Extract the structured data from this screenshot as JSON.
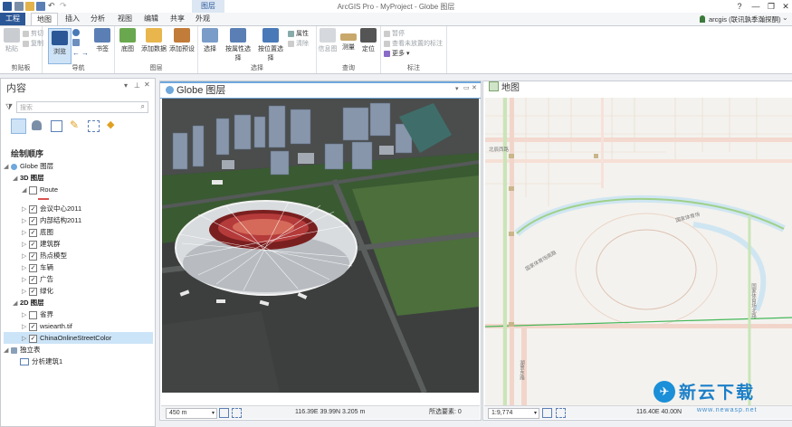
{
  "app": {
    "title": "ArcGIS Pro - MyProject - Globe 图层",
    "context_tab": "图层",
    "user": "arcgis (联讯孰季瀚探酮)"
  },
  "window_controls": {
    "help": "?",
    "minimize": "—",
    "restore": "❐",
    "close": "✕"
  },
  "tabs": [
    {
      "label": "工程",
      "active": false
    },
    {
      "label": "地图",
      "active": true
    },
    {
      "label": "插入",
      "active": false
    },
    {
      "label": "分析",
      "active": false
    },
    {
      "label": "视图",
      "active": false
    },
    {
      "label": "编辑",
      "active": false
    },
    {
      "label": "共享",
      "active": false
    },
    {
      "label": "外观",
      "active": false
    }
  ],
  "ribbon": {
    "clipboard": {
      "group": "剪贴板",
      "paste": "粘贴",
      "cut": "剪切",
      "copy": "复制"
    },
    "navigate": {
      "group": "导航",
      "explore": "浏览",
      "bookmarks": "书签"
    },
    "layer": {
      "group": "图层",
      "basemap": "底图",
      "add_data": "添加数据",
      "add_preset": "添加预设"
    },
    "selection": {
      "group": "选择",
      "select": "选择",
      "select_by_attr": "按属性选择",
      "select_by_loc": "按位置选择",
      "attributes": "属性",
      "clear": "清除"
    },
    "inquiry": {
      "group": "查询",
      "infographics": "信息图",
      "measure": "测量",
      "locate": "定位"
    },
    "labeling": {
      "group": "标注",
      "pause": "暂停",
      "view_unplaced": "查看未放置的标注",
      "more": "更多"
    }
  },
  "contents": {
    "title": "内容",
    "search_placeholder": "搜索",
    "drawing_order": "绘制顺序",
    "items": [
      {
        "label": "Globe 图层",
        "level": 0,
        "checkbox": false,
        "caret": "◢"
      },
      {
        "label": "3D 图层",
        "level": 1,
        "checkbox": false,
        "caret": "◢",
        "bold": true
      },
      {
        "label": "Route",
        "level": 2,
        "checkbox": true,
        "checked": false,
        "caret": "◢"
      },
      {
        "label": "会议中心2011",
        "level": 2,
        "checkbox": true,
        "checked": true,
        "caret": "▷"
      },
      {
        "label": "内部结构2011",
        "level": 2,
        "checkbox": true,
        "checked": true,
        "caret": "▷"
      },
      {
        "label": "底图",
        "level": 2,
        "checkbox": true,
        "checked": true,
        "caret": "▷"
      },
      {
        "label": "建筑群",
        "level": 2,
        "checkbox": true,
        "checked": true,
        "caret": "▷"
      },
      {
        "label": "热点模型",
        "level": 2,
        "checkbox": true,
        "checked": true,
        "caret": "▷"
      },
      {
        "label": "车辆",
        "level": 2,
        "checkbox": true,
        "checked": true,
        "caret": "▷"
      },
      {
        "label": "广告",
        "level": 2,
        "checkbox": true,
        "checked": true,
        "caret": "▷"
      },
      {
        "label": "绿化",
        "level": 2,
        "checkbox": true,
        "checked": true,
        "caret": "▷"
      },
      {
        "label": "2D 图层",
        "level": 1,
        "checkbox": false,
        "caret": "◢",
        "bold": true
      },
      {
        "label": "省界",
        "level": 2,
        "checkbox": true,
        "checked": false,
        "caret": "▷"
      },
      {
        "label": "wsiearth.tif",
        "level": 2,
        "checkbox": true,
        "checked": true,
        "caret": "▷"
      },
      {
        "label": "ChinaOnlineStreetColor",
        "level": 2,
        "checkbox": true,
        "checked": true,
        "caret": "▷",
        "selected": true
      },
      {
        "label": "独立表",
        "level": 0,
        "checkbox": false,
        "caret": "◢"
      },
      {
        "label": "分析建筑1",
        "level": 1,
        "checkbox": false,
        "caret": ""
      }
    ]
  },
  "globe_view": {
    "title": "Globe 图层",
    "scale": "450 m",
    "coords": "116.39E 39.99N  3.205 m",
    "selected_features": "所选要素: 0"
  },
  "map_view": {
    "title": "地图",
    "scale": "1:9,774",
    "coords": "116.40E 40.00N",
    "road_labels": [
      "北辰西路",
      "国家体育场",
      "国家体育场南路",
      "国家体育场北路",
      "湖景东路"
    ]
  },
  "watermark": {
    "brand": "新云下载",
    "url": "www.newasp.net"
  },
  "colors": {
    "accent": "#2b5797",
    "selection": "#cce4f7",
    "tab_blue": "#6fa8dc"
  }
}
